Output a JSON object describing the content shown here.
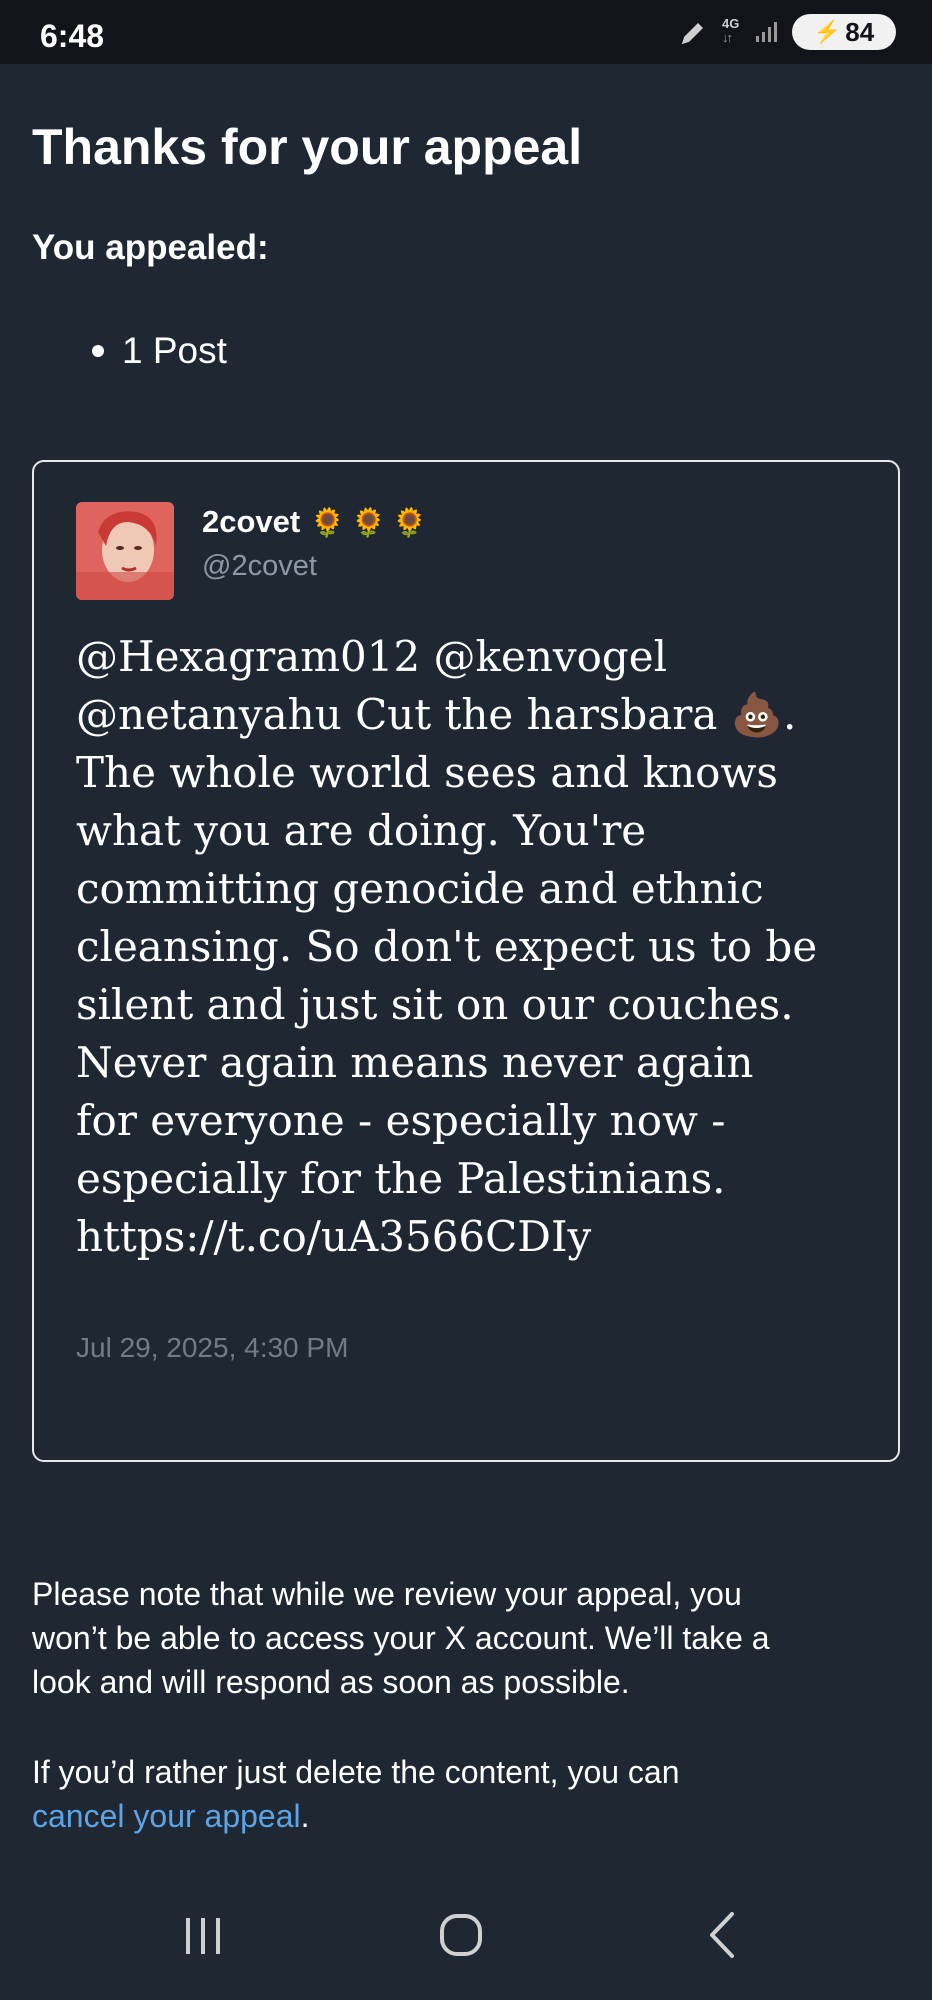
{
  "status_bar": {
    "time": "6:48",
    "network": "4G",
    "battery": "84"
  },
  "page": {
    "title": "Thanks for your appeal",
    "subtitle": "You appealed:",
    "appealed_items": [
      "1 Post"
    ]
  },
  "post": {
    "author_name": "2covet",
    "author_emoji": "🌻🌻🌻",
    "author_handle": "@2covet",
    "text_lines": [
      "@Hexagram012 @kenvogel",
      "@netanyahu Cut the harsbara 💩.",
      "The whole world sees and knows",
      "what you are doing. You're",
      "committing genocide and ethnic",
      "cleansing. So don't expect us to be",
      "silent and just sit on our couches.",
      "Never again means never again",
      "for everyone - especially now -",
      "especially for the Palestinians.",
      "https://t.co/uA3566CDIy"
    ],
    "date": "Jul 29, 2025, 4:30 PM"
  },
  "notice": {
    "line1": "Please note that while we review your appeal, you",
    "line2": "won’t be able to access your X account. We’ll take a",
    "line3": "look and will respond as soon as possible.",
    "delete_prefix": "If you’d rather just delete the content, you can",
    "cancel_link": "cancel your appeal",
    "delete_suffix": "."
  },
  "colors": {
    "background": "#1f2733",
    "link": "#5ba4e6",
    "muted": "#8b98a5"
  },
  "icons": {
    "edit": "pencil-icon",
    "signal": "signal-icon",
    "battery": "battery-icon",
    "nav_recents": "recents-icon",
    "nav_home": "home-icon",
    "nav_back": "back-icon"
  }
}
